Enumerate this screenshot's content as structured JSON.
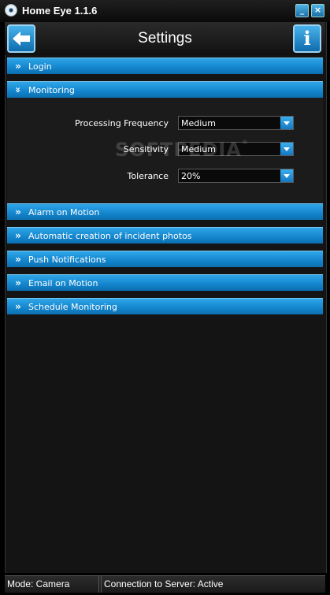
{
  "window": {
    "title": "Home Eye 1.1.6",
    "minimize_glyph": "_",
    "close_glyph": "×"
  },
  "header": {
    "title": "Settings",
    "info_glyph": "i"
  },
  "sections": {
    "login": "Login",
    "monitoring": "Monitoring",
    "alarm": "Alarm on Motion",
    "incident_photos": "Automatic creation of incident photos",
    "push": "Push Notifications",
    "email": "Email on Motion",
    "schedule": "Schedule Monitoring"
  },
  "monitoring": {
    "processing_frequency": {
      "label": "Processing Frequency",
      "value": "Medium"
    },
    "sensitivity": {
      "label": "Sensitivity",
      "value": "Medium"
    },
    "tolerance": {
      "label": "Tolerance",
      "value": "20%"
    }
  },
  "watermark": {
    "text": "SOFTPEDIA",
    "mark": "®"
  },
  "status": {
    "mode": "Mode: Camera",
    "connection": "Connection to Server: Active"
  },
  "glyphs": {
    "collapsed": "»",
    "expanded": "»"
  },
  "colors": {
    "accent": "#1b8fd6",
    "background": "#000000"
  }
}
